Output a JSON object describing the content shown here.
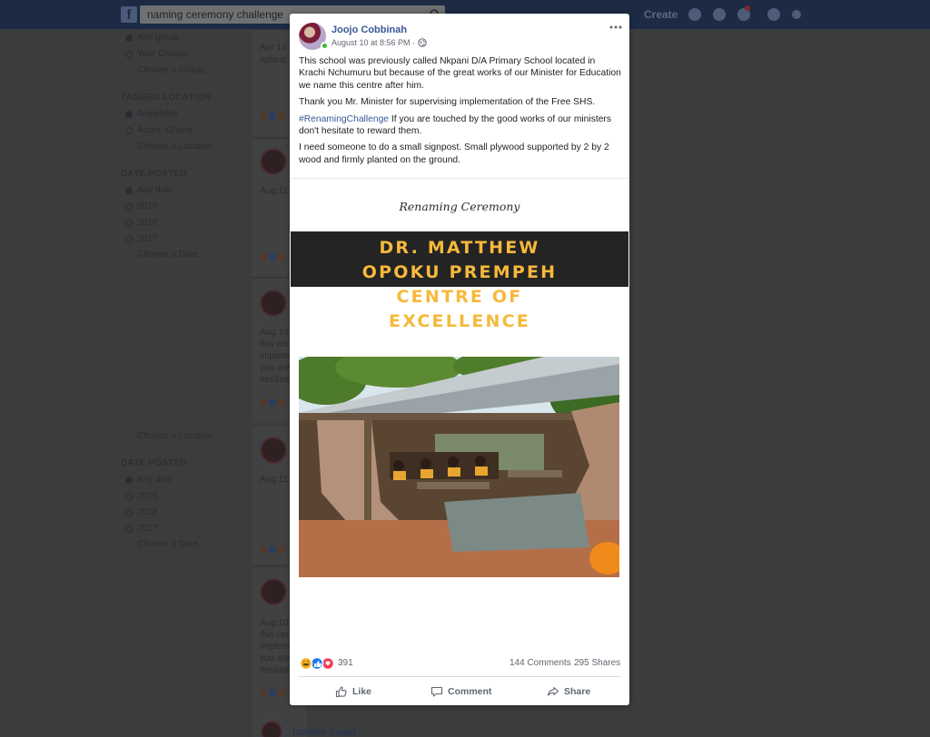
{
  "background": {
    "search_query": "naming ceremony challenge",
    "create_label": "Create",
    "sidebar": {
      "group1_options": [
        "Any group",
        "Your Groups",
        "Choose a Group..."
      ],
      "tagged_location_title": "TAGGED LOCATION",
      "location_options": [
        "Anywhere",
        "Accra, Ghana",
        "Choose a Location..."
      ],
      "date_posted_title": "DATE POSTED",
      "date_options": [
        "Any date",
        "2019",
        "2018",
        "2017",
        "Choose a Date..."
      ],
      "location_choose_2": "Choose a Location...",
      "date_posted_title_2": "DATE POSTED",
      "date_options_2": [
        "Any date",
        "2019",
        "2018",
        "2017",
        "Choose a Date..."
      ]
    },
    "feed": {
      "snippet_date_1": "Apr 13",
      "snippet_hashtag_1": "#planti",
      "snippet_date_2": "Aug 11",
      "snippet_date_3": "Aug 10",
      "snippet_text_3": [
        "this cen",
        "impleme",
        "you are",
        "hesitate"
      ],
      "snippet_date_4": "Aug 11",
      "snippet_date_5": "Aug 10",
      "snippet_text_5": [
        "this cen",
        "impleme",
        "you are",
        "hesitate"
      ],
      "next_author": "Ismaila Yusuf"
    }
  },
  "post": {
    "author": "Joojo Cobbinah",
    "timestamp": "August 10 at 8:56 PM ·",
    "paragraph_1": "This school was previously called Nkpani D/A Primary School located in Krachi Nchumuru but because of the great works of our Minister for Education we name this centre after him.",
    "paragraph_2": "Thank you Mr. Minister for supervising implementation of the Free SHS.",
    "hashtag": "#RenamingChallenge",
    "paragraph_3_rest": " If you are touched by the good works of our ministers don't hesitate to reward them.",
    "paragraph_4": "I need someone to do a small signpost. Small plywood supported by 2 by 2 wood and firmly planted on the ground.",
    "image": {
      "ceremony_title": "Renaming Ceremony",
      "name_line_1": "DR. MATTHEW",
      "name_line_2": "OPOKU PREMPEH",
      "centre_line_1": "CENTRE OF",
      "centre_line_2": "EXCELLENCE"
    },
    "reactions_count": "391",
    "comments_count": "144 Comments",
    "shares_count": "295 Shares",
    "actions": {
      "like": "Like",
      "comment": "Comment",
      "share": "Share"
    }
  },
  "colors": {
    "link_blue": "#385898",
    "banner_gold": "#f6b93b",
    "banner_dark": "#242424",
    "online_green": "#42b72a"
  }
}
